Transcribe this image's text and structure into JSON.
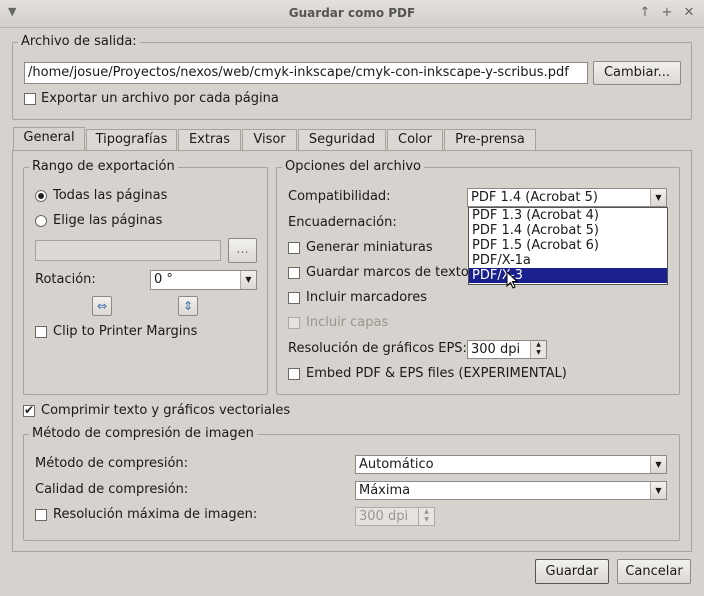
{
  "window": {
    "title": "Guardar como PDF"
  },
  "output": {
    "legend": "Archivo de salida:",
    "path": "/home/josue/Proyectos/nexos/web/cmyk-inkscape/cmyk-con-inkscape-y-scribus.pdf",
    "change_label": "Cambiar...",
    "export_each_label": "Exportar un archivo por cada página",
    "export_each_checked": false
  },
  "tabs": [
    "General",
    "Tipografías",
    "Extras",
    "Visor",
    "Seguridad",
    "Color",
    "Pre-prensa"
  ],
  "export_range": {
    "legend": "Rango de exportación",
    "all_pages": "Todas las páginas",
    "choose_pages": "Elige las páginas",
    "selected": "all_pages",
    "dots": "...",
    "rotation_label": "Rotación:",
    "rotation_value": "0 °",
    "clip_label": "Clip to Printer Margins"
  },
  "file_options": {
    "legend": "Opciones del archivo",
    "compat_label": "Compatibilidad:",
    "compat_value": "PDF 1.4 (Acrobat 5)",
    "binding_label": "Encuadernación:",
    "thumbnails": "Generar miniaturas",
    "save_marks": "Guardar marcos de texto",
    "bookmarks": "Incluir marcadores",
    "layers": "Incluir capas",
    "eps_res_label": "Resolución de gráficos EPS:",
    "eps_res_value": "300 dpi",
    "embed_label": "Embed PDF & EPS files (EXPERIMENTAL)"
  },
  "compat_options": [
    "PDF 1.3 (Acrobat 4)",
    "PDF 1.4 (Acrobat 5)",
    "PDF 1.5 (Acrobat 6)",
    "PDF/X-1a",
    "PDF/X-3"
  ],
  "compress_vectors_label": "Comprimir texto y gráficos vectoriales",
  "image_compression": {
    "legend": "Método de compresión de imagen",
    "method_label": "Método de compresión:",
    "method_value": "Automático",
    "quality_label": "Calidad de compresión:",
    "quality_value": "Máxima",
    "max_res_label": "Resolución máxima de imagen:",
    "max_res_value": "300 dpi"
  },
  "buttons": {
    "save": "Guardar",
    "cancel": "Cancelar"
  },
  "icons": {
    "arrow": "▼",
    "check": "✔",
    "up": "▲",
    "down": "▼",
    "radio_dot": "●"
  }
}
